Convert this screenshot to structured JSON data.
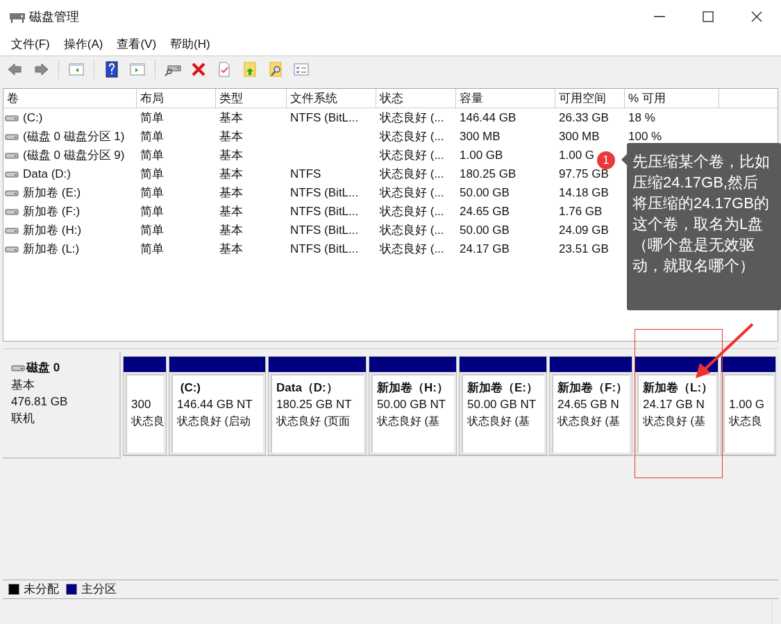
{
  "window": {
    "title": "磁盘管理"
  },
  "menu": [
    "文件(F)",
    "操作(A)",
    "查看(V)",
    "帮助(H)"
  ],
  "table": {
    "columns": [
      "卷",
      "布局",
      "类型",
      "文件系统",
      "状态",
      "容量",
      "可用空间",
      "% 可用"
    ],
    "rows": [
      {
        "volume": " (C:)",
        "layout": "简单",
        "type": "基本",
        "fs": "NTFS (BitL...",
        "status": "状态良好 (...",
        "capacity": "146.44 GB",
        "free": "26.33 GB",
        "pct": "18 %"
      },
      {
        "volume": "(磁盘 0 磁盘分区 1)",
        "layout": "简单",
        "type": "基本",
        "status": "状态良好 (...",
        "capacity": "300 MB",
        "free": "300 MB",
        "pct": "100 %"
      },
      {
        "volume": "(磁盘 0 磁盘分区 9)",
        "layout": "简单",
        "type": "基本",
        "status": "状态良好 (...",
        "capacity": "1.00 GB",
        "free": "1.00 G"
      },
      {
        "volume": "Data (D:)",
        "layout": "简单",
        "type": "基本",
        "fs": "NTFS",
        "status": "状态良好 (...",
        "capacity": "180.25 GB",
        "free": "97.75 GB"
      },
      {
        "volume": "新加卷 (E:)",
        "layout": "简单",
        "type": "基本",
        "fs": "NTFS (BitL...",
        "status": "状态良好 (...",
        "capacity": "50.00 GB",
        "free": "14.18 GB"
      },
      {
        "volume": "新加卷 (F:)",
        "layout": "简单",
        "type": "基本",
        "fs": "NTFS (BitL...",
        "status": "状态良好 (...",
        "capacity": "24.65 GB",
        "free": "1.76 GB"
      },
      {
        "volume": "新加卷 (H:)",
        "layout": "简单",
        "type": "基本",
        "fs": "NTFS (BitL...",
        "status": "状态良好 (...",
        "capacity": "50.00 GB",
        "free": "24.09 GB"
      },
      {
        "volume": "新加卷 (L:)",
        "layout": "简单",
        "type": "基本",
        "fs": "NTFS (BitL...",
        "status": "状态良好 (...",
        "capacity": "24.17 GB",
        "free": "23.51 GB"
      }
    ]
  },
  "disk": {
    "name": "磁盘 0",
    "type": "基本",
    "size": "476.81 GB",
    "status": "联机"
  },
  "partitions": [
    {
      "size": "300",
      "status": "状态良"
    },
    {
      "title": " (C:)",
      "size": "146.44 GB NT",
      "status": "状态良好 (启动"
    },
    {
      "title": "Data（D:）",
      "size": "180.25 GB NT",
      "status": "状态良好 (页面"
    },
    {
      "title": "新加卷（H:）",
      "size": "50.00 GB NT",
      "status": "状态良好 (基"
    },
    {
      "title": "新加卷（E:）",
      "size": "50.00 GB NT",
      "status": "状态良好 (基"
    },
    {
      "title": "新加卷（F:）",
      "size": "24.65 GB N",
      "status": "状态良好 (基"
    },
    {
      "title": "新加卷（L:）",
      "size": "24.17 GB N",
      "status": "状态良好 (基"
    },
    {
      "size": "1.00 G",
      "status": "状态良"
    }
  ],
  "legend": [
    {
      "label": "未分配",
      "color": "#000000"
    },
    {
      "label": "主分区",
      "color": "#000080"
    }
  ],
  "annotation": {
    "badge": "1",
    "text": "先压缩某个卷，比如压缩24.17GB,然后将压缩的24.17GB的这个卷，取名为L盘（哪个盘是无效驱动，就取名哪个）"
  }
}
